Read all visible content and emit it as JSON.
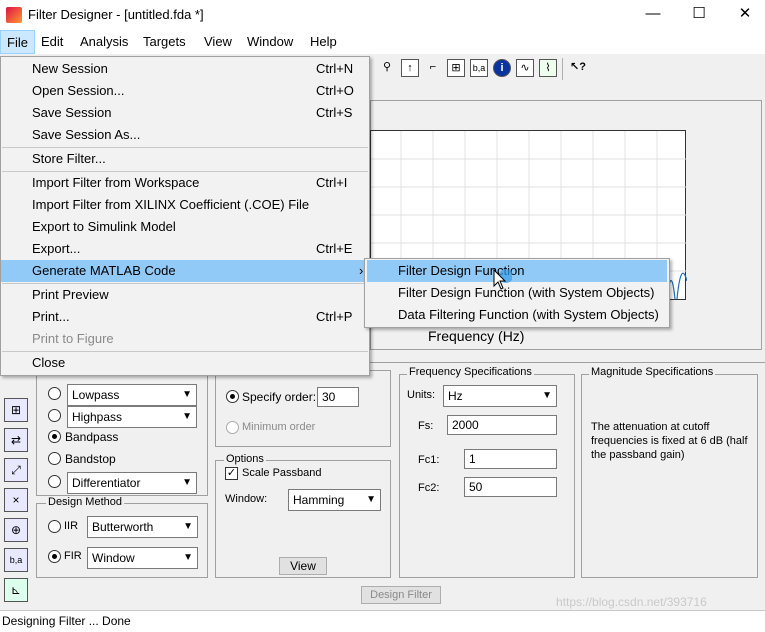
{
  "window": {
    "title": "Filter Designer - [untitled.fda *]",
    "minimize": "—",
    "maximize": "☐",
    "close": "✕"
  },
  "menubar": [
    "File",
    "Edit",
    "Analysis",
    "Targets",
    "View",
    "Window",
    "Help"
  ],
  "file_menu": [
    {
      "label": "New Session",
      "shortcut": "Ctrl+N"
    },
    {
      "label": "Open Session...",
      "shortcut": "Ctrl+O"
    },
    {
      "label": "Save Session",
      "shortcut": "Ctrl+S"
    },
    {
      "label": "Save Session As...",
      "shortcut": ""
    },
    {
      "label": "Store Filter...",
      "shortcut": ""
    },
    {
      "label": "Import Filter from Workspace",
      "shortcut": "Ctrl+I"
    },
    {
      "label": "Import Filter from XILINX Coefficient (.COE) File",
      "shortcut": ""
    },
    {
      "label": "Export to Simulink Model",
      "shortcut": ""
    },
    {
      "label": "Export...",
      "shortcut": "Ctrl+E"
    },
    {
      "label": "Generate MATLAB Code",
      "shortcut": "›"
    },
    {
      "label": "Print Preview",
      "shortcut": ""
    },
    {
      "label": "Print...",
      "shortcut": "Ctrl+P"
    },
    {
      "label": "Print to Figure",
      "shortcut": ""
    },
    {
      "label": "Close",
      "shortcut": ""
    }
  ],
  "submenu": [
    "Filter Design Function",
    "Filter Design Function (with System Objects)",
    "Data Filtering Function (with System Objects)"
  ],
  "plot": {
    "xlabel": "Frequency (Hz)"
  },
  "response_type": {
    "options": [
      "Lowpass",
      "Highpass",
      "Bandpass",
      "Bandstop",
      "Differentiator"
    ],
    "selected": "Bandpass"
  },
  "design_method": {
    "title": "Design Method",
    "iir_label": "IIR",
    "iir_value": "Butterworth",
    "fir_label": "FIR",
    "fir_value": "Window"
  },
  "filter_order": {
    "specify_label": "Specify order:",
    "order_value": "30",
    "minimum_label": "Minimum order"
  },
  "options": {
    "title": "Options",
    "scale_passband": "Scale Passband",
    "window_label": "Window:",
    "window_value": "Hamming",
    "view_button": "View"
  },
  "freq_specs": {
    "title": "Frequency Specifications",
    "units_label": "Units:",
    "units_value": "Hz",
    "fs_label": "Fs:",
    "fs_value": "2000",
    "fc1_label": "Fc1:",
    "fc1_value": "1",
    "fc2_label": "Fc2:",
    "fc2_value": "50"
  },
  "mag_specs": {
    "title": "Magnitude Specifications",
    "text": "The attenuation at cutoff frequencies is fixed at 6 dB (half the passband gain)"
  },
  "design_button": "Design Filter",
  "status": "Designing Filter ... Done",
  "watermark": "https://blog.csdn.net/393716"
}
